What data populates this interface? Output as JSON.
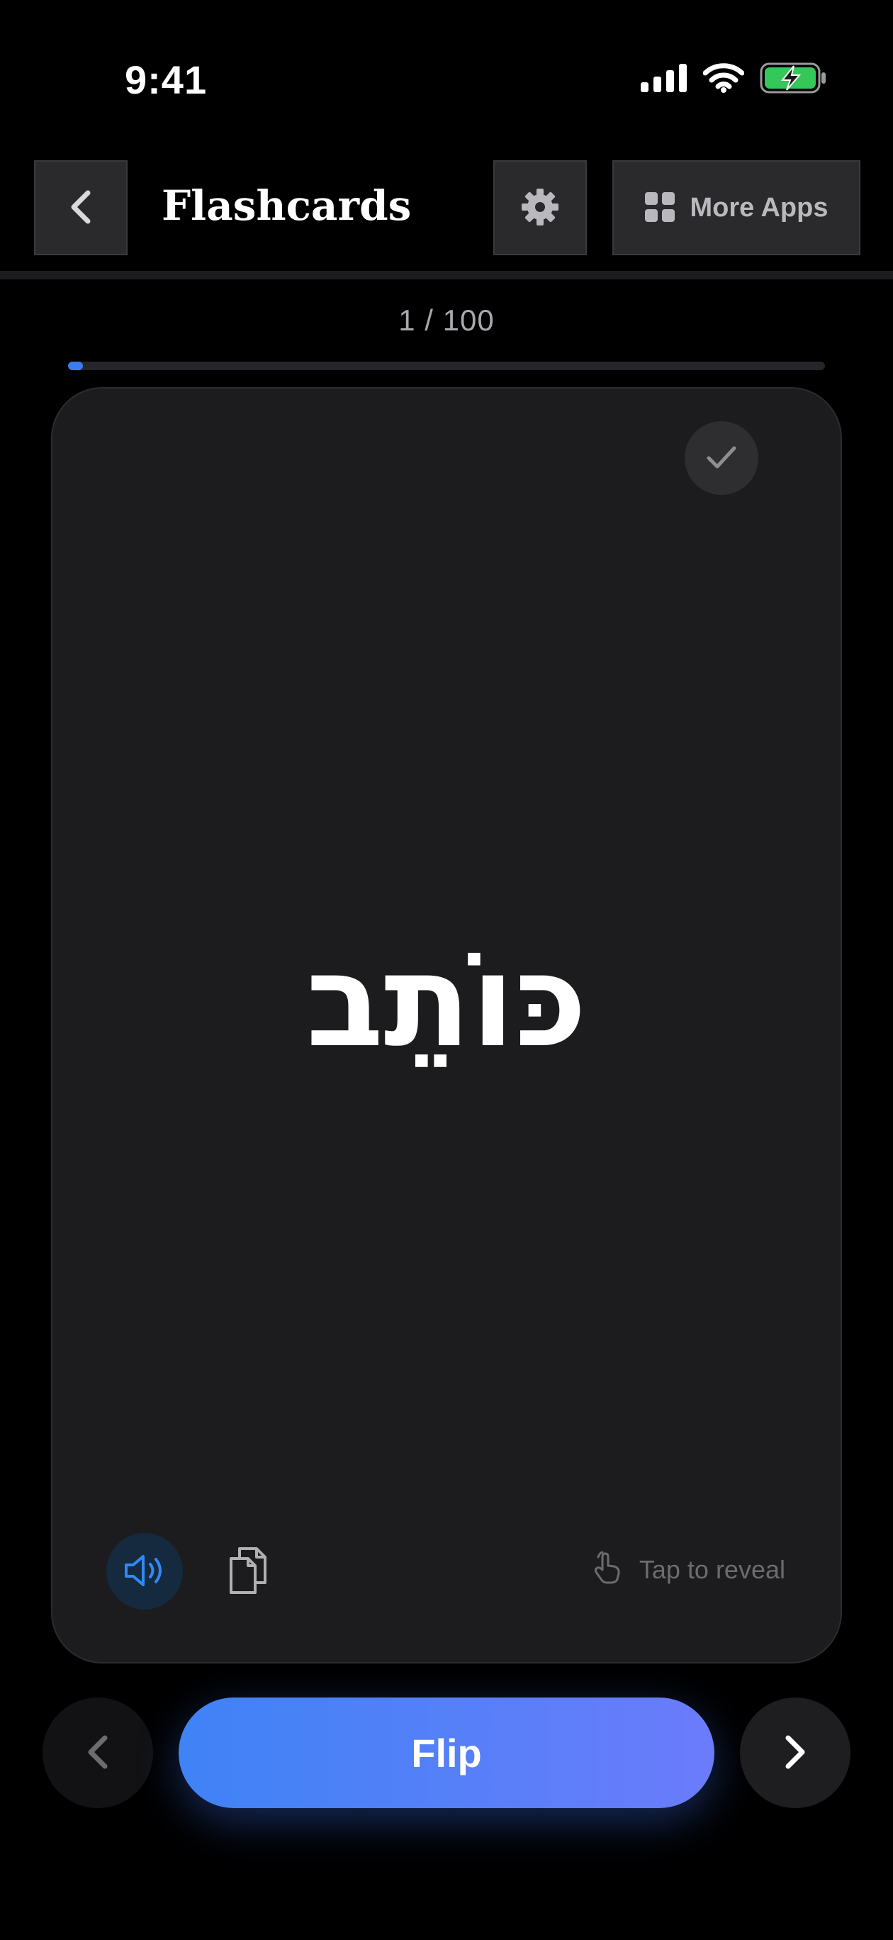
{
  "status_bar": {
    "time": "9:41",
    "icons": [
      "cellular-signal-icon",
      "wifi-icon",
      "battery-charging-icon"
    ],
    "battery_color": "#34c759"
  },
  "header": {
    "title": "Flashcards",
    "back_icon": "chevron-left-icon",
    "settings_icon": "gear-icon",
    "more_apps_icon": "grid-icon",
    "more_apps_label": "More Apps"
  },
  "progress": {
    "label": "1 / 100",
    "current": 1,
    "total": 100,
    "accent": "#3b7cf0"
  },
  "card": {
    "word": "כּוֹתֵב",
    "known_icon": "checkmark-icon",
    "audio_icon": "speaker-icon",
    "copy_icon": "copy-icon",
    "tap_icon": "tap-hand-icon",
    "tap_hint": "Tap to reveal"
  },
  "controls": {
    "prev_icon": "chevron-left-icon",
    "flip_label": "Flip",
    "next_icon": "chevron-right-icon",
    "flip_gradient": [
      "#3f83f6",
      "#6b7cfb"
    ]
  }
}
